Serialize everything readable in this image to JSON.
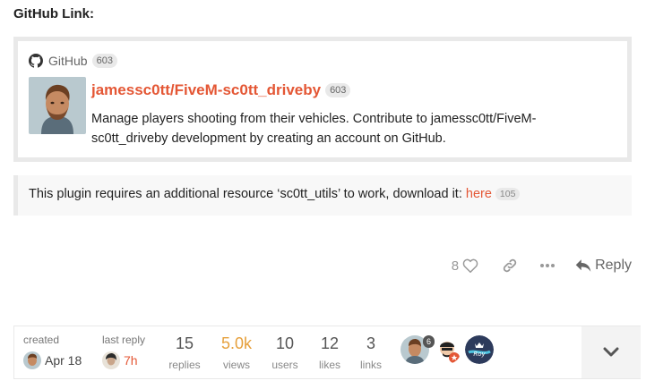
{
  "heading": "GitHub Link:",
  "onebox": {
    "source_label": "GitHub",
    "source_clicks": "603",
    "repo_title": "jamessc0tt/FiveM-sc0tt_driveby",
    "repo_clicks": "603",
    "description": "Manage players shooting from their vehicles. Contribute to jamessc0tt/FiveM-sc0tt_driveby development by creating an account on GitHub."
  },
  "quote": {
    "text": "This plugin requires an additional resource ‘sc0tt_utils’ to work, download it: ",
    "link_text": "here",
    "link_clicks": "105"
  },
  "actions": {
    "like_count": "8",
    "reply_label": "Reply"
  },
  "topic_map": {
    "created_label": "created",
    "created_date": "Apr 18",
    "last_reply_label": "last reply",
    "last_reply_time": "7h",
    "stats": [
      {
        "value": "15",
        "label": "replies"
      },
      {
        "value": "5.0k",
        "label": "views"
      },
      {
        "value": "10",
        "label": "users"
      },
      {
        "value": "12",
        "label": "likes"
      },
      {
        "value": "3",
        "label": "links"
      }
    ],
    "top_poster_count": "6"
  },
  "colors": {
    "accent": "#e45735",
    "views_highlight": "#e6a03c"
  }
}
